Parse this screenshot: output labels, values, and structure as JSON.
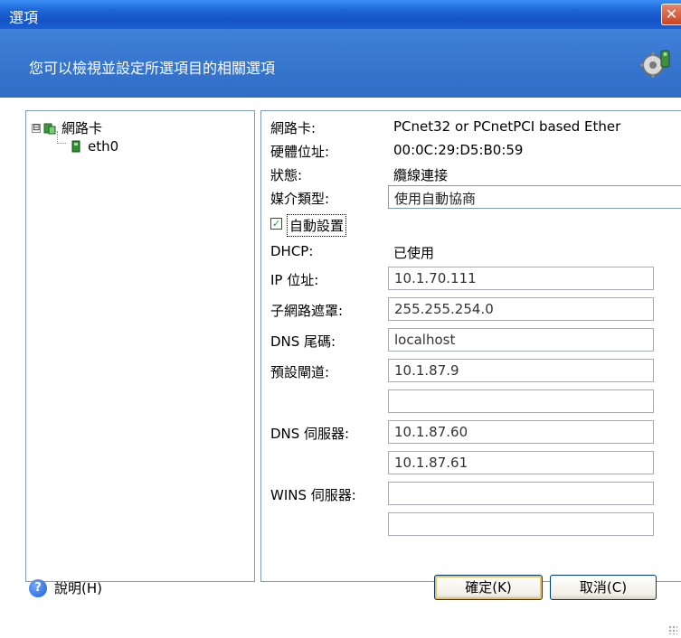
{
  "window": {
    "title": "選項",
    "close_symbol": "✕"
  },
  "header": {
    "subtitle": "您可以檢視並設定所選項目的相關選項",
    "icon": "gear-settings-icon"
  },
  "tree": {
    "root": {
      "label": "網路卡",
      "expander": "⊟",
      "icon": "network-icon"
    },
    "child": {
      "label": "eth0",
      "icon": "network-adapter-icon"
    }
  },
  "props": {
    "adapter": {
      "label": "網路卡:",
      "value": "PCnet32 or PCnetPCI based Ether"
    },
    "mac": {
      "label": "硬體位址:",
      "value": "00:0C:29:D5:B0:59"
    },
    "status": {
      "label": "狀態:",
      "value": "纜線連接"
    },
    "media": {
      "label": "媒介類型:",
      "value": "使用自動協商"
    },
    "auto_config": {
      "label": "自動設置",
      "checked": true,
      "check_symbol": "✓"
    },
    "dhcp": {
      "label": "DHCP:",
      "value": "已使用"
    },
    "ip": {
      "label": "IP 位址:",
      "value": "10.1.70.111"
    },
    "subnet": {
      "label": "子網路遮罩:",
      "value": "255.255.254.0"
    },
    "dns_suffix": {
      "label": "DNS 尾碼:",
      "value": "localhost"
    },
    "gateway": {
      "label": "預設閘道:",
      "values": [
        "10.1.87.9",
        ""
      ]
    },
    "dns_servers": {
      "label": "DNS 伺服器:",
      "values": [
        "10.1.87.60",
        "10.1.87.61"
      ]
    },
    "wins_servers": {
      "label": "WINS 伺服器:",
      "values": [
        "",
        ""
      ]
    }
  },
  "footer": {
    "help_label": "說明(H)",
    "help_icon": "?",
    "ok_label": "確定(K)",
    "cancel_label": "取消(C)"
  },
  "colors": {
    "title_bar": "#1d66d8",
    "header": "#3a77d0",
    "button_border": "#003c74"
  }
}
